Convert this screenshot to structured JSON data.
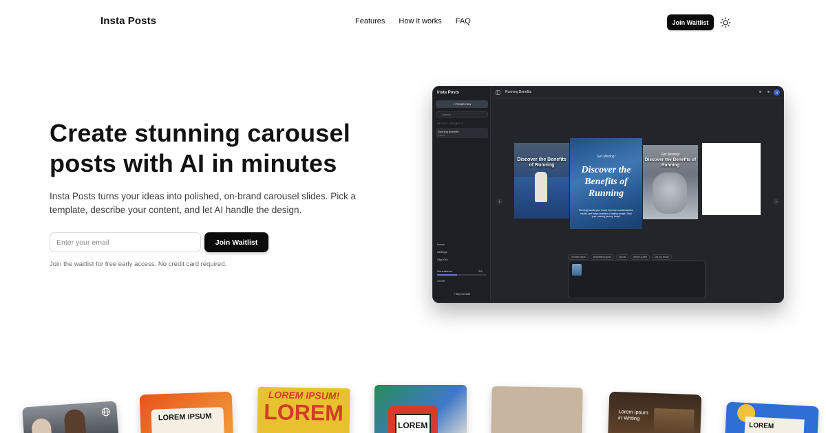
{
  "nav": {
    "brand": "Insta Posts",
    "links": [
      "Features",
      "How it works",
      "FAQ"
    ],
    "cta_label": "Join Waitlist",
    "theme_icon": "sun-icon"
  },
  "hero": {
    "title": "Create stunning carousel posts with AI in minutes",
    "description": "Insta Posts turns your ideas into polished, on-brand carousel slides. Pick a template, describe your content, and let AI handle the design.",
    "email_placeholder": "Enter your email",
    "cta_label": "Join Waitlist",
    "note": "Join the waitlist for free early access. No credit card required."
  },
  "app_preview": {
    "logo": "Insta Posts",
    "create_label": "+ Create new",
    "search_placeholder": "Search",
    "recent_section": "RECENT PROJECTS",
    "recent_title": "Running Benefits",
    "recent_subtitle": "4 slides",
    "doc_title": "Running Benefits",
    "avatar_initial": "N",
    "nav_items": [
      "Home",
      "Settings",
      "Sign Out"
    ],
    "generations_label": "Generations",
    "generations_count": "2/5",
    "credits_left": "3/5 left",
    "buy_label": "+ Buy Credits",
    "slides": {
      "left_caption": "Discover the Benefits of Running",
      "center_top": "Get Moving!",
      "center_caption": "Discover the Benefits of Running",
      "center_body": "Running boosts your mood, improves cardiovascular health, and helps maintain a healthy weight. Start your running journey today!",
      "right_top": "Get Moving!",
      "right_caption": "Discover the Benefits of Running"
    },
    "chips": [
      "Try these ideas",
      "Motivational quote",
      "Tips list",
      "Before & After",
      "Did you know?"
    ]
  },
  "templates": [
    {
      "name": "team-photo-template",
      "text": ""
    },
    {
      "name": "orange-lorem-template",
      "text": "LOREM IPSUM"
    },
    {
      "name": "yellow-lorem-template",
      "text": "LOREM IPSUM!"
    },
    {
      "name": "blue-retro-template",
      "text": "LOREM"
    },
    {
      "name": "beige-paper-template",
      "text": ""
    },
    {
      "name": "library-writing-template",
      "text": "Lorem ipsum in Writing"
    },
    {
      "name": "blue-badge-template",
      "text": "LOREM"
    }
  ],
  "colors": {
    "primary": "#0b0b0b",
    "app_bg": "#23252b",
    "accent_blue": "#3f63d6"
  }
}
